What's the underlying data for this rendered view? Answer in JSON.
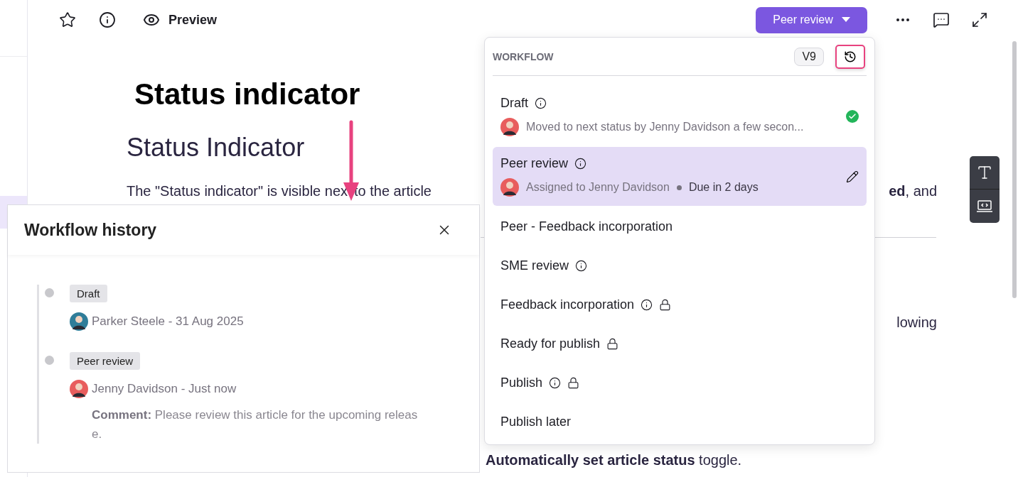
{
  "topbar": {
    "preview_label": "Preview",
    "status_button": "Peer review"
  },
  "article": {
    "title": "Status indicator",
    "heading": "Status Indicator",
    "lines": [
      {
        "kind": "full",
        "left": "The \"Status indicator\" is visible nex",
        "after": "to the article",
        "right": "**ed**, and"
      },
      {
        "kind": "rule"
      },
      {
        "kind": "gap",
        "right": "lowing"
      },
      {
        "kind": "gap",
        "left": "**Automatically set article status** toggle."
      }
    ]
  },
  "workflow": {
    "title": "WORKFLOW",
    "version": "V9",
    "statuses": [
      {
        "label": "Draft",
        "info": true,
        "locked": false,
        "selected": false,
        "completed": true,
        "editable": false,
        "detail": "Moved to next status by Jenny Davidson a few secon..."
      },
      {
        "label": "Peer review",
        "info": true,
        "locked": false,
        "selected": true,
        "completed": false,
        "editable": true,
        "detail": "Assigned to Jenny Davidson",
        "due": "Due in 2 days"
      },
      {
        "label": "Peer - Feedback incorporation",
        "info": false,
        "locked": false,
        "selected": false,
        "completed": false,
        "editable": false
      },
      {
        "label": "SME review",
        "info": true,
        "locked": false,
        "selected": false,
        "completed": false,
        "editable": false
      },
      {
        "label": "Feedback incorporation",
        "info": true,
        "locked": true,
        "selected": false,
        "completed": false,
        "editable": false
      },
      {
        "label": "Ready for publish",
        "info": false,
        "locked": true,
        "selected": false,
        "completed": false,
        "editable": false
      },
      {
        "label": "Publish",
        "info": true,
        "locked": true,
        "selected": false,
        "completed": false,
        "editable": false
      },
      {
        "label": "Publish later",
        "info": false,
        "locked": false,
        "selected": false,
        "completed": false,
        "editable": false
      }
    ]
  },
  "history": {
    "title": "Workflow history",
    "entries": [
      {
        "status": "Draft",
        "byline": "Parker Steele - 31 Aug 2025",
        "color": "#2f7d99"
      },
      {
        "status": "Peer review",
        "byline": "Jenny Davidson - Just now",
        "color": "#e85d5d",
        "comment": "**Comment:** Please review this article for the upcoming release."
      }
    ]
  }
}
